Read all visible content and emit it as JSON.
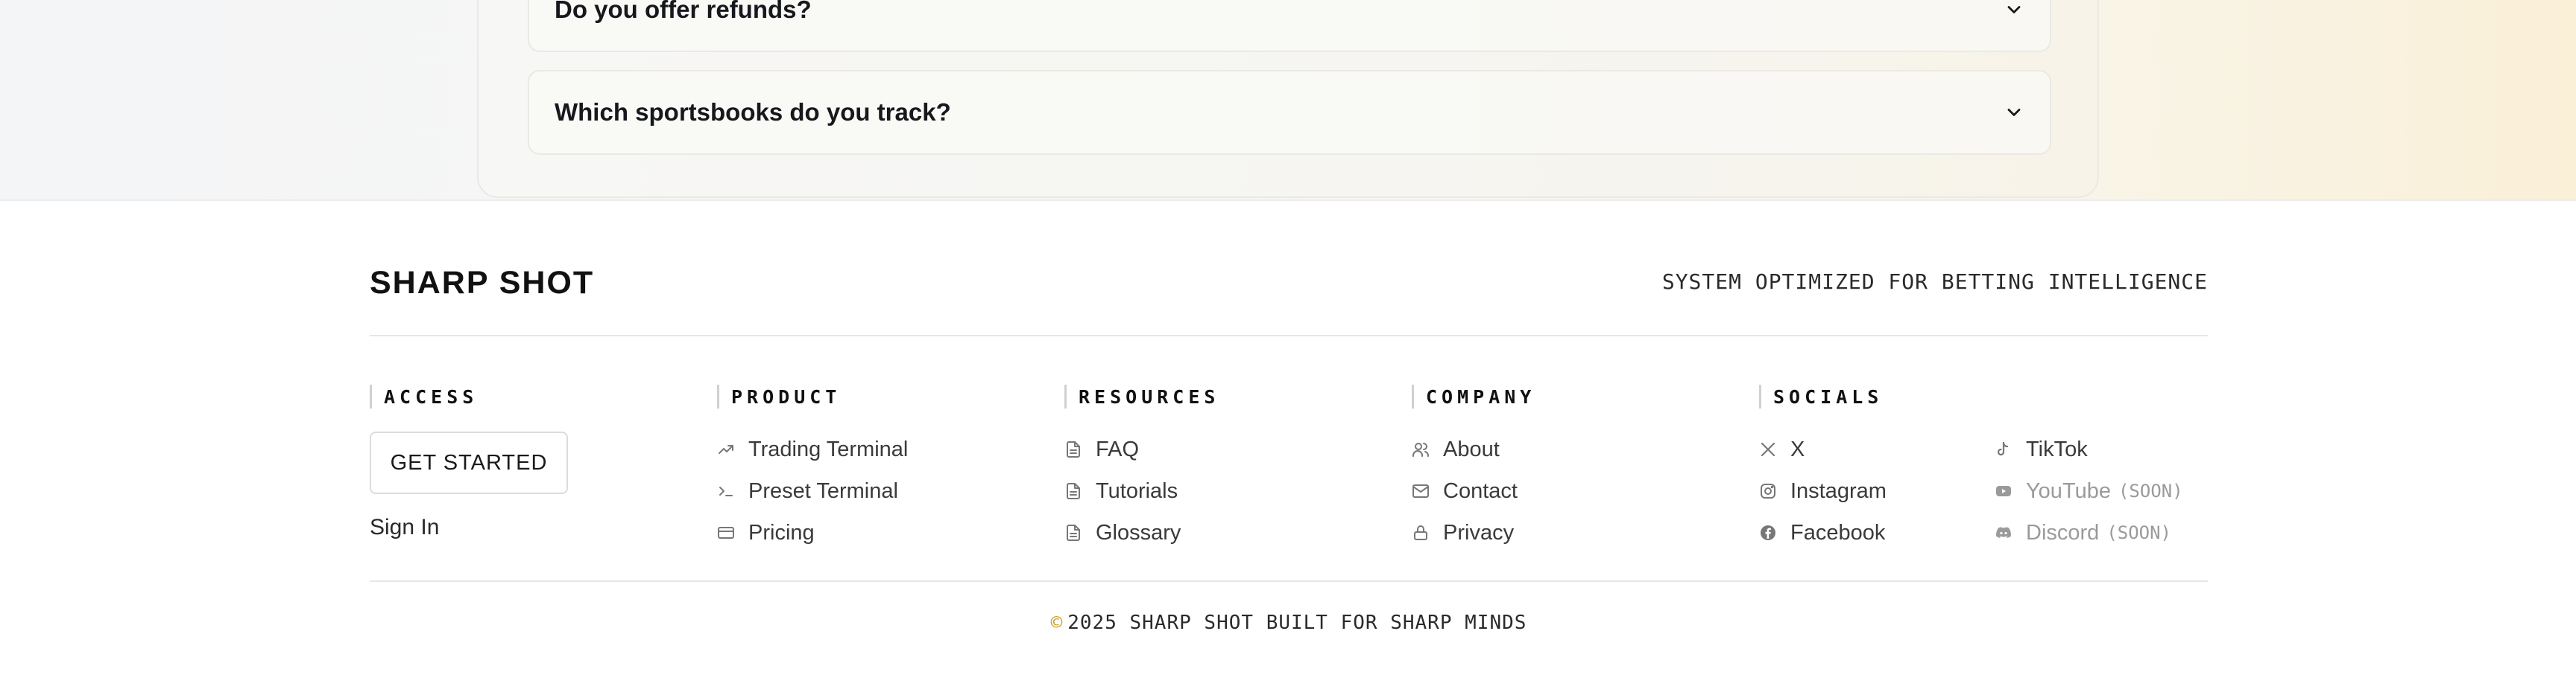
{
  "faq": {
    "items": [
      {
        "question": "Do you offer refunds?"
      },
      {
        "question": "Which sportsbooks do you track?"
      }
    ]
  },
  "footer": {
    "brand": "SHARP SHOT",
    "tagline": "SYSTEM OPTIMIZED FOR BETTING INTELLIGENCE",
    "access": {
      "heading": "ACCESS",
      "get_started": "GET STARTED",
      "sign_in": "Sign In"
    },
    "product": {
      "heading": "PRODUCT",
      "links": [
        {
          "label": "Trading Terminal",
          "icon": "trending-up-icon"
        },
        {
          "label": "Preset Terminal",
          "icon": "terminal-icon"
        },
        {
          "label": "Pricing",
          "icon": "credit-card-icon"
        }
      ]
    },
    "resources": {
      "heading": "RESOURCES",
      "links": [
        {
          "label": "FAQ",
          "icon": "document-icon"
        },
        {
          "label": "Tutorials",
          "icon": "document-icon"
        },
        {
          "label": "Glossary",
          "icon": "document-icon"
        }
      ]
    },
    "company": {
      "heading": "COMPANY",
      "links": [
        {
          "label": "About",
          "icon": "users-icon"
        },
        {
          "label": "Contact",
          "icon": "mail-icon"
        },
        {
          "label": "Privacy",
          "icon": "lock-icon"
        }
      ]
    },
    "socials": {
      "heading": "SOCIALS",
      "left": [
        {
          "label": "X",
          "icon": "x-icon"
        },
        {
          "label": "Instagram",
          "icon": "instagram-icon"
        },
        {
          "label": "Facebook",
          "icon": "facebook-icon"
        }
      ],
      "right": [
        {
          "label": "TikTok",
          "icon": "tiktok-icon"
        },
        {
          "label": "YouTube",
          "soon": "(SOON)",
          "icon": "youtube-icon"
        },
        {
          "label": "Discord",
          "soon": "(SOON)",
          "icon": "discord-icon"
        }
      ]
    },
    "copyright": {
      "symbol": "©",
      "text": "2025 SHARP SHOT BUILT FOR SHARP MINDS"
    }
  },
  "colors": {
    "accent_gold": "#c9a227",
    "muted_text": "#9a9a9a"
  }
}
